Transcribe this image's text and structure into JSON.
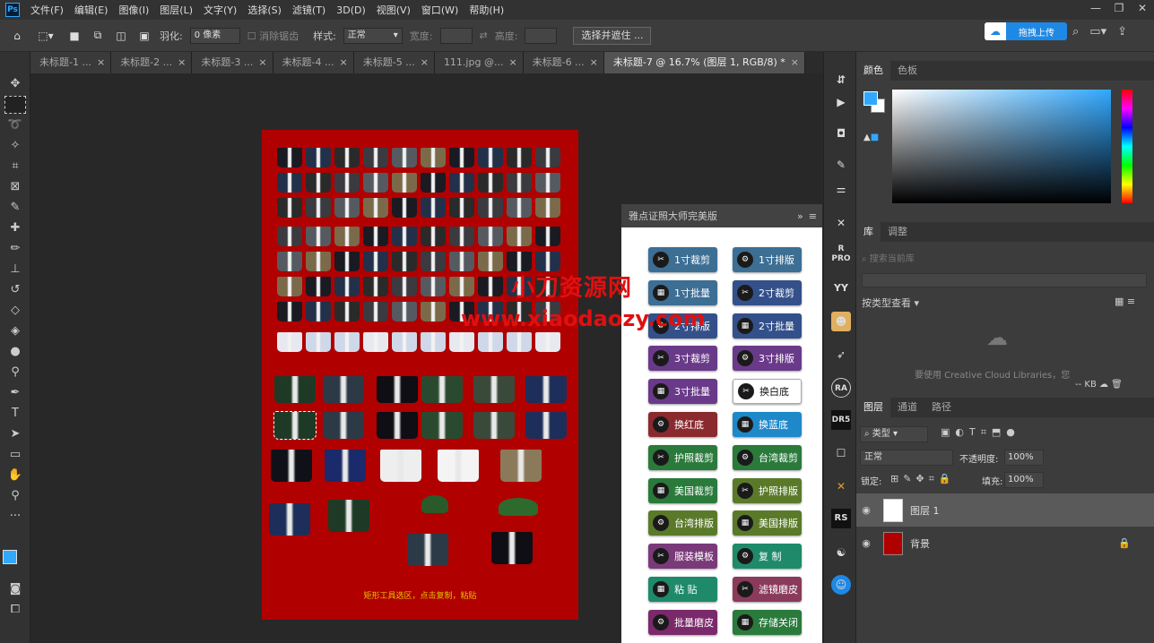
{
  "app": {
    "logo": "Ps"
  },
  "menu": [
    "文件(F)",
    "编辑(E)",
    "图像(I)",
    "图层(L)",
    "文字(Y)",
    "选择(S)",
    "滤镜(T)",
    "3D(D)",
    "视图(V)",
    "窗口(W)",
    "帮助(H)"
  ],
  "options": {
    "feather_label": "羽化:",
    "feather_value": "0 像素",
    "antialias_label": "消除锯齿",
    "style_label": "样式:",
    "style_value": "正常",
    "width_label": "宽度:",
    "height_label": "高度:",
    "select_mask_button": "选择并遮住 ...",
    "upload_button": "拖拽上传"
  },
  "tabs": [
    "未标题-1 ...",
    "未标题-2 ...",
    "未标题-3 ...",
    "未标题-4 ...",
    "未标题-5 ...",
    "111.jpg @...",
    "未标题-6 ...",
    "未标题-7 @ 16.7% (图层 1, RGB/8) *"
  ],
  "document": {
    "caption": "矩形工具选区，点击复制，粘贴"
  },
  "watermark": {
    "line1": "小刀资源网",
    "line2": "www.xiaodaozy.com"
  },
  "plugin": {
    "title": "雅点证照大师完美版",
    "buttons": [
      {
        "label": "1寸裁剪",
        "color": "#3d6e94"
      },
      {
        "label": "1寸排版",
        "color": "#3d6e94"
      },
      {
        "label": "1寸批量",
        "color": "#3d6e94"
      },
      {
        "label": "2寸裁剪",
        "color": "#33508a"
      },
      {
        "label": "2寸排版",
        "color": "#33508a"
      },
      {
        "label": "2寸批量",
        "color": "#33508a"
      },
      {
        "label": "3寸裁剪",
        "color": "#6a3a8a"
      },
      {
        "label": "3寸排版",
        "color": "#6a3a8a"
      },
      {
        "label": "3寸批量",
        "color": "#6a3a8a"
      },
      {
        "label": "换白底",
        "color": "#ffffff"
      },
      {
        "label": "换红底",
        "color": "#8a2a2e"
      },
      {
        "label": "换蓝底",
        "color": "#1e88c8"
      },
      {
        "label": "护照裁剪",
        "color": "#2a7a3c"
      },
      {
        "label": "台湾裁剪",
        "color": "#2a7a3c"
      },
      {
        "label": "美国裁剪",
        "color": "#2a7a3c"
      },
      {
        "label": "护照排版",
        "color": "#5a7a2a"
      },
      {
        "label": "台湾排版",
        "color": "#5a7a2a"
      },
      {
        "label": "美国排版",
        "color": "#5a7a2a"
      },
      {
        "label": "服装模板",
        "color": "#7a3a7a"
      },
      {
        "label": "复 制",
        "color": "#1e8a6a"
      },
      {
        "label": "粘 贴",
        "color": "#1e8a6a"
      },
      {
        "label": "滤镜磨皮",
        "color": "#8a3a5a"
      },
      {
        "label": "批量磨皮",
        "color": "#7a2a6a"
      },
      {
        "label": "存储关闭",
        "color": "#2a7a3c"
      }
    ]
  },
  "color_panel": {
    "tabs": [
      "颜色",
      "色板"
    ]
  },
  "library_panel": {
    "tabs": [
      "库",
      "调整"
    ],
    "search_placeholder": "搜索当前库",
    "view_label": "按类型查看",
    "empty_hint": "要使用 Creative Cloud Libraries，您",
    "kb": "-- KB"
  },
  "layers_panel": {
    "tabs": [
      "图层",
      "通道",
      "路径"
    ],
    "filter": "类型",
    "blend": "正常",
    "opacity_label": "不透明度:",
    "opacity": "100%",
    "lock_label": "锁定:",
    "fill_label": "填充:",
    "fill": "100%",
    "layers": [
      {
        "name": "图层 1"
      },
      {
        "name": "背景"
      }
    ]
  },
  "strip_icons": [
    "R PRO",
    "YY",
    "RA",
    "DR5",
    "RS"
  ],
  "colors": {
    "foreground": "#31a8ff",
    "document_bg": "#b00000"
  }
}
